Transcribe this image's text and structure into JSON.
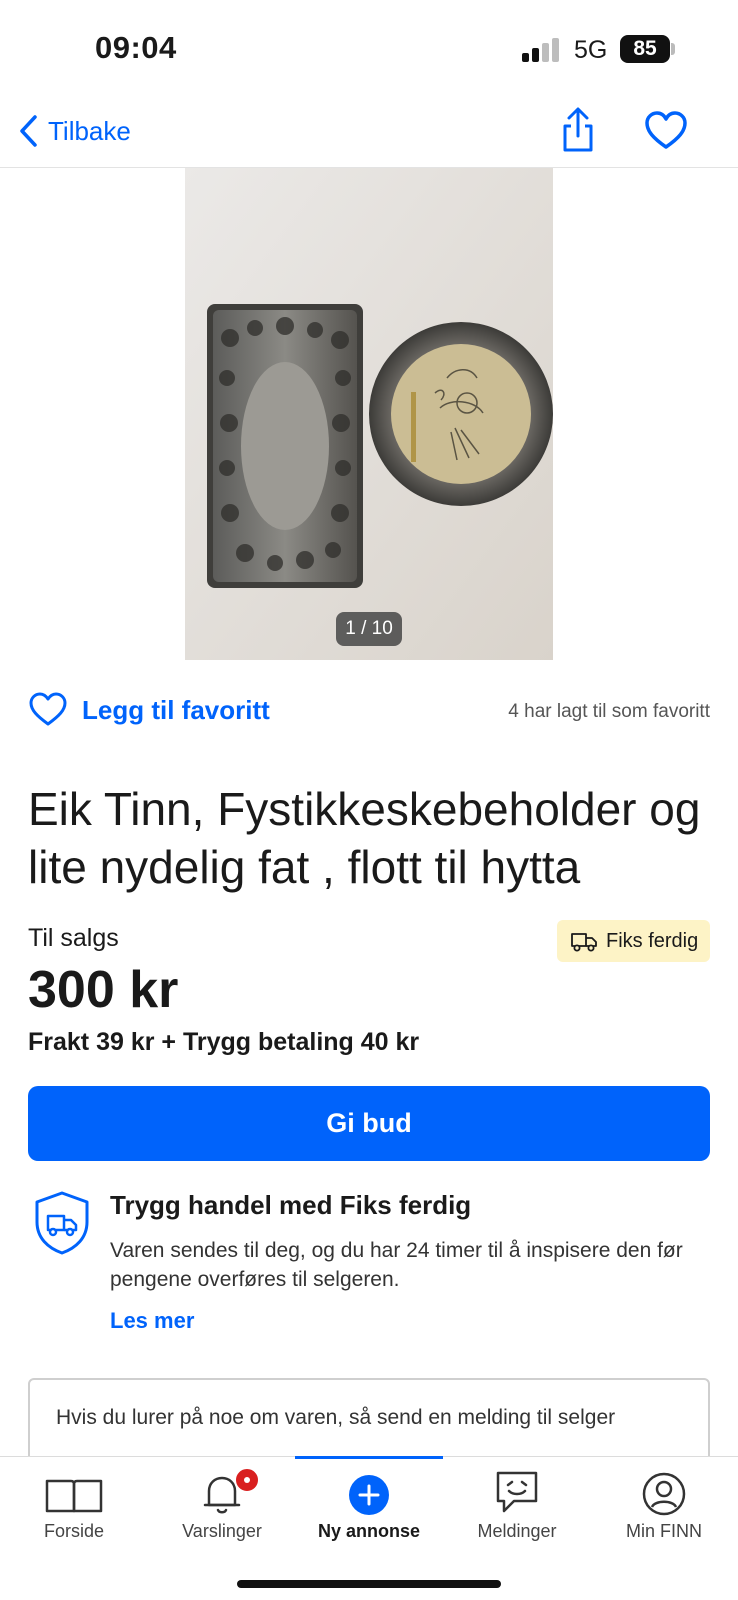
{
  "status_bar": {
    "time": "09:04",
    "network": "5G",
    "battery": "85"
  },
  "nav": {
    "back_label": "Tilbake"
  },
  "gallery": {
    "counter": "1 / 10"
  },
  "favorite": {
    "add_label": "Legg til favoritt",
    "count_text": "4 har lagt til som favoritt"
  },
  "listing": {
    "title": "Eik Tinn, Fystikkeskebeholder og lite nydelig fat , flott til hytta",
    "sale_label": "Til salgs",
    "badge": "Fiks ferdig",
    "price": "300 kr",
    "shipping": "Frakt 39 kr + Trygg betaling 40 kr"
  },
  "actions": {
    "bid_label": "Gi bud"
  },
  "safe_trade": {
    "title": "Trygg handel med Fiks ferdig",
    "text": "Varen sendes til deg, og du har 24 timer til å inspisere den før pengene overføres til selgeren.",
    "read_more": "Les mer"
  },
  "message": {
    "prompt": "Hvis du lurer på noe om varen, så send en melding til selger"
  },
  "tabs": [
    {
      "label": "Forside",
      "icon": "book-icon"
    },
    {
      "label": "Varslinger",
      "icon": "bell-icon"
    },
    {
      "label": "Ny annonse",
      "icon": "plus-circle-icon"
    },
    {
      "label": "Meldinger",
      "icon": "chat-icon"
    },
    {
      "label": "Min FINN",
      "icon": "profile-icon"
    }
  ],
  "colors": {
    "accent": "#0063fb",
    "badge_bg": "#fdf3c6",
    "notification": "#d91f1f"
  }
}
